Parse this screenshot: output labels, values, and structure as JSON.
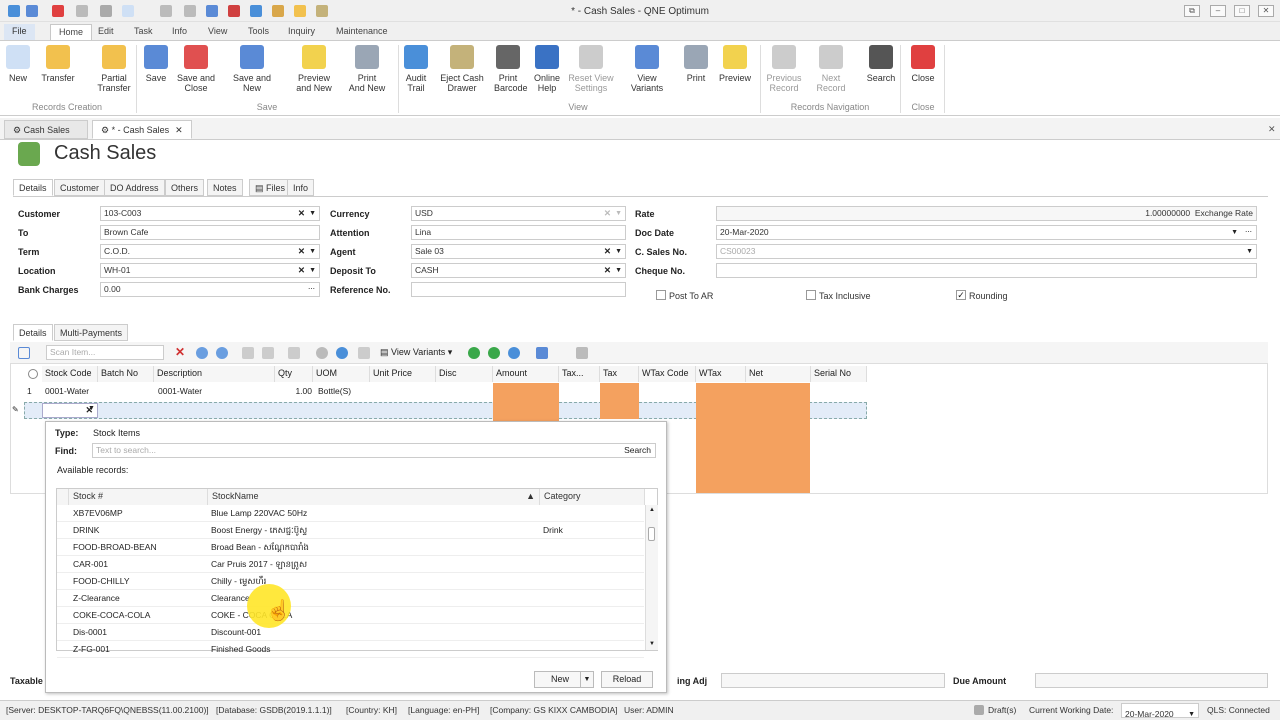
{
  "window": {
    "title": "* - Cash Sales - QNE Optimum"
  },
  "menu": [
    "File",
    "Home",
    "Edit",
    "Task",
    "Info",
    "View",
    "Tools",
    "Inquiry",
    "Maintenance"
  ],
  "ribbon": {
    "buttons": [
      {
        "l1": "New",
        "l2": "",
        "name": "new-button",
        "icon": "new-doc-icon",
        "col": "#cfe0f5"
      },
      {
        "l1": "Transfer",
        "l2": "",
        "name": "transfer-button",
        "icon": "transfer-icon",
        "col": "#f2c14e"
      },
      {
        "l1": "Partial",
        "l2": "Transfer",
        "name": "partial-transfer-button",
        "icon": "partial-transfer-icon",
        "col": "#f2c14e"
      },
      {
        "l1": "Save",
        "l2": "",
        "name": "save-button",
        "icon": "save-icon",
        "col": "#5a8ad6"
      },
      {
        "l1": "Save and",
        "l2": "Close",
        "name": "save-and-close-button",
        "icon": "save-close-icon",
        "col": "#e05050"
      },
      {
        "l1": "Save and New",
        "l2": "",
        "name": "save-and-new-button",
        "icon": "save-new-icon",
        "col": "#5a8ad6"
      },
      {
        "l1": "Preview",
        "l2": "and New",
        "name": "preview-and-new-button",
        "icon": "preview-icon",
        "col": "#f2d24e"
      },
      {
        "l1": "Print",
        "l2": "And New",
        "name": "print-and-new-button",
        "icon": "print-icon",
        "col": "#9aa6b5"
      },
      {
        "l1": "Audit",
        "l2": "Trail",
        "name": "audit-trail-button",
        "icon": "audit-trail-icon",
        "col": "#4a8fd9"
      },
      {
        "l1": "Eject Cash",
        "l2": "Drawer",
        "name": "eject-cash-drawer-button",
        "icon": "cash-drawer-icon",
        "col": "#c4b27a"
      },
      {
        "l1": "Print",
        "l2": "Barcode",
        "name": "print-barcode-button",
        "icon": "barcode-icon",
        "col": "#666"
      },
      {
        "l1": "Online",
        "l2": "Help",
        "name": "online-help-button",
        "icon": "help-icon",
        "col": "#3a72c4"
      },
      {
        "l1": "Reset View",
        "l2": "Settings",
        "name": "reset-view-settings-button",
        "icon": "reset-view-icon",
        "col": "#ccc"
      },
      {
        "l1": "View Variants",
        "l2": "",
        "name": "view-variants-button",
        "icon": "view-variants-icon",
        "col": "#5a8ad6"
      },
      {
        "l1": "Print",
        "l2": "",
        "name": "print-button",
        "icon": "print-icon",
        "col": "#9aa6b5"
      },
      {
        "l1": "Preview",
        "l2": "",
        "name": "preview-button",
        "icon": "preview-icon",
        "col": "#f2d24e"
      },
      {
        "l1": "Previous",
        "l2": "Record",
        "name": "previous-record-button",
        "icon": "up-arrow-icon",
        "col": "#ccc"
      },
      {
        "l1": "Next Record",
        "l2": "",
        "name": "next-record-button",
        "icon": "down-arrow-icon",
        "col": "#ccc"
      },
      {
        "l1": "Search",
        "l2": "",
        "name": "search-button",
        "icon": "binoculars-icon",
        "col": "#555"
      },
      {
        "l1": "Close",
        "l2": "",
        "name": "close-button",
        "icon": "close-icon",
        "col": "#e04040"
      }
    ],
    "groups": [
      "Records Creation",
      "Save",
      "View",
      "Records Navigation",
      "Close"
    ]
  },
  "doc_tabs": [
    "Cash Sales",
    "* - Cash Sales"
  ],
  "page_title": "Cash Sales",
  "detail_tabs": [
    "Details",
    "Customer",
    "DO Address",
    "Others",
    "Notes",
    "Files",
    "Info"
  ],
  "form": {
    "customer_label": "Customer",
    "customer": "103-C003",
    "to_label": "To",
    "to": "Brown Cafe",
    "term_label": "Term",
    "term": "C.O.D.",
    "location_label": "Location",
    "location": "WH-01",
    "bank_label": "Bank Charges",
    "bank": "0.00",
    "currency_label": "Currency",
    "currency": "USD",
    "attention_label": "Attention",
    "attention": "Lina",
    "agent_label": "Agent",
    "agent": "Sale 03",
    "deposit_label": "Deposit To",
    "deposit": "CASH",
    "ref_label": "Reference No.",
    "ref": "",
    "rate_label": "Rate",
    "rate": "1.00000000",
    "rate_suffix": "Exchange Rate",
    "docdate_label": "Doc Date",
    "docdate": "20-Mar-2020",
    "csales_label": "C. Sales No.",
    "csales": "CS00023",
    "cheque_label": "Cheque No.",
    "cheque": "",
    "post_ar": "Post To AR",
    "tax_inclusive": "Tax Inclusive",
    "rounding": "Rounding"
  },
  "lower_tabs": [
    "Details",
    "Multi-Payments"
  ],
  "grid_toolbar": {
    "scan_placeholder": "Scan Item...",
    "view_variants": "View Variants"
  },
  "grid": {
    "headers": [
      "Stock Code",
      "Batch No",
      "Description",
      "Qty",
      "UOM",
      "Unit Price",
      "Disc",
      "Amount",
      "Tax...",
      "Tax",
      "WTax Code",
      "WTax",
      "Net",
      "Serial No"
    ],
    "row1": {
      "num": "1",
      "code": "0001-Water",
      "desc": "0001-Water",
      "qty": "1.00",
      "uom": "Bottle(S)"
    }
  },
  "popup": {
    "type_label": "Type:",
    "type": "Stock Items",
    "find_label": "Find:",
    "find_placeholder": "Text to search...",
    "search": "Search",
    "available": "Available records:",
    "headers": [
      "Stock #",
      "StockName",
      "Category"
    ],
    "rows": [
      {
        "stock": "XB7EV06MP",
        "name": "Blue Lamp 220VAC 50Hz",
        "cat": ""
      },
      {
        "stock": "DRINK",
        "name": "Boost Energy - ភេសជ្ជៈប៊ូស្ទ",
        "cat": "Drink"
      },
      {
        "stock": "FOOD-BROAD-BEAN",
        "name": "Broad Bean - សណ្តែកបារាំង",
        "cat": ""
      },
      {
        "stock": "CAR-001",
        "name": "Car Pruis 2017 - ឡានព្រូស",
        "cat": ""
      },
      {
        "stock": "FOOD-CHILLY",
        "name": "Chilly - ម្ទេសហឹរ",
        "cat": ""
      },
      {
        "stock": "Z-Clearance",
        "name": "Clearance",
        "cat": ""
      },
      {
        "stock": "COKE-COCA-COLA",
        "name": "COKE - COCA COLA",
        "cat": ""
      },
      {
        "stock": "Dis-0001",
        "name": "Discount-001",
        "cat": ""
      },
      {
        "stock": "Z-FG-001",
        "name": "Finished Goods",
        "cat": ""
      }
    ],
    "new": "New",
    "reload": "Reload"
  },
  "bottom": {
    "taxable": "Taxable",
    "rounding_adj": "ing Adj",
    "due_amount": "Due Amount"
  },
  "status": {
    "server": "[Server: DESKTOP-TARQ6FQ\\QNEBSS(11.00.2100)]",
    "database": "[Database: GSDB(2019.1.1.1)]",
    "country": "[Country: KH]",
    "language": "[Language: en-PH]",
    "company": "[Company: GS KIXX CAMBODIA]",
    "user": "User: ADMIN",
    "drafts": "Draft(s)",
    "working_label": "Current Working Date:",
    "working_date": "20-Mar-2020",
    "qls": "QLS: Connected"
  },
  "colors": {
    "accent": "#f4a15f",
    "tab_blue": "#dce6f4"
  }
}
